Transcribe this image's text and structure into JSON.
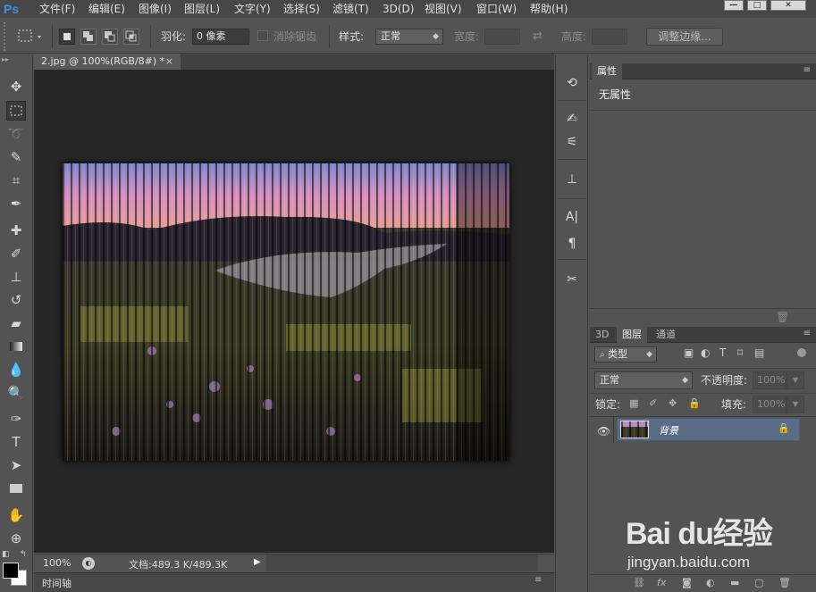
{
  "app": {
    "logo": "Ps"
  },
  "menubar": {
    "items": [
      "文件(F)",
      "编辑(E)",
      "图像(I)",
      "图层(L)",
      "文字(Y)",
      "选择(S)",
      "滤镜(T)",
      "3D(D)",
      "视图(V)",
      "窗口(W)",
      "帮助(H)"
    ],
    "window_controls": [
      "minimize",
      "maximize",
      "close"
    ]
  },
  "options": {
    "feather_label": "羽化:",
    "feather_value": "0 像素",
    "antialias_label": "消除锯齿",
    "style_label": "样式:",
    "style_value": "正常",
    "width_label": "宽度:",
    "height_label": "高度:",
    "refine_edge_button": "调整边缘..."
  },
  "document": {
    "tab_title": "2.jpg @ 100%(RGB/8#) *",
    "close_glyph": "×",
    "zoom": "100%",
    "doc_info": "文档:489.3 K/489.3K"
  },
  "timeline": {
    "label": "时间轴"
  },
  "properties": {
    "tab": "属性",
    "content": "无属性"
  },
  "layers_panel": {
    "tabs": [
      "3D",
      "图层",
      "通道"
    ],
    "active_tab": "图层",
    "filter_kind": "类型",
    "blend_mode": "正常",
    "opacity_label": "不透明度:",
    "opacity_value": "100%",
    "lock_label": "锁定:",
    "fill_label": "填充:",
    "fill_value": "100%",
    "layers": [
      {
        "name": "背景",
        "visible": true,
        "locked": true
      }
    ]
  },
  "watermark": {
    "brand": "Bai du经验",
    "url": "jingyan.baidu.com"
  },
  "colors": {
    "brand_blue": "#3d8ee6",
    "selected_layer": "#5a6c86",
    "canvas_bg": "#262626"
  }
}
